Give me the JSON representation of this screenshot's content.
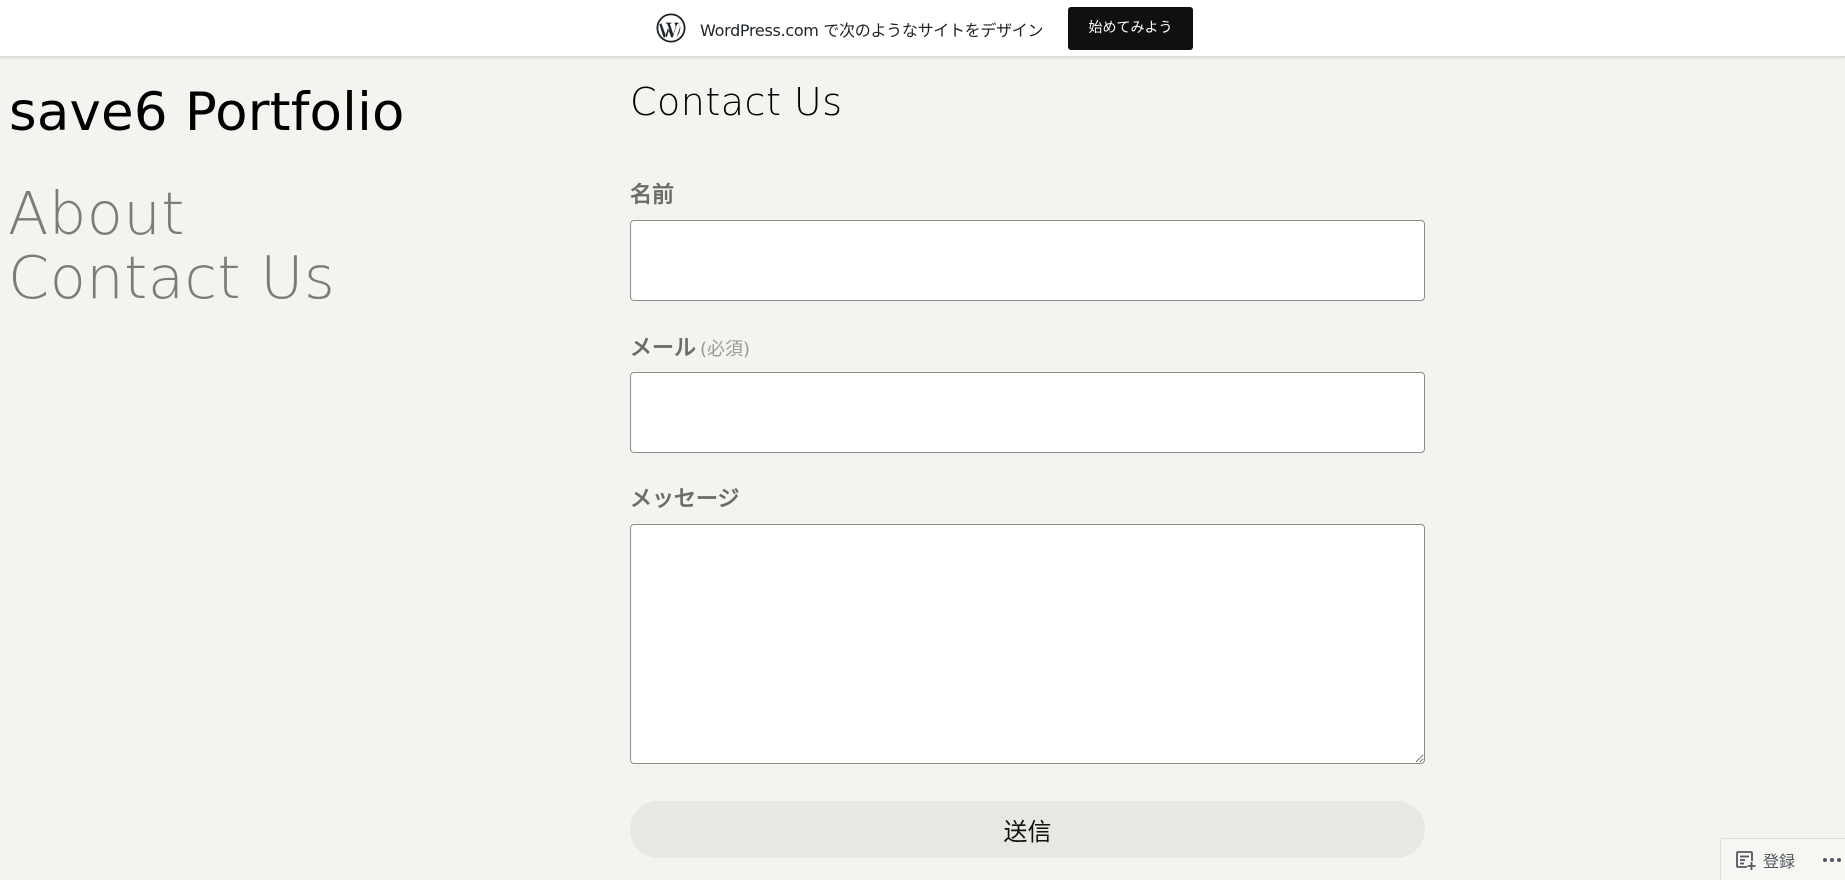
{
  "wp_banner": {
    "brand": "WordPress.com",
    "message": " で次のようなサイトをデザイン",
    "cta_label": "始めてみよう"
  },
  "site": {
    "title": "save6 Portfolio",
    "nav": [
      {
        "label": "About"
      },
      {
        "label": "Contact Us"
      }
    ]
  },
  "main": {
    "page_title": "Contact Us",
    "form": {
      "name_label": "名前",
      "email_label": "メール",
      "email_required": "(必須)",
      "message_label": "メッセージ",
      "name_value": "",
      "email_value": "",
      "message_value": "",
      "submit_label": "送信"
    }
  },
  "action_bar": {
    "subscribe_label": "登録",
    "more_icon": "ellipsis-icon",
    "subscribe_icon": "reader-plus-icon"
  },
  "colors": {
    "page_background": "#f4f3ef",
    "cta_background": "#101010",
    "nav_link": "#7b7b78",
    "submit_background": "#e8e7e2"
  }
}
